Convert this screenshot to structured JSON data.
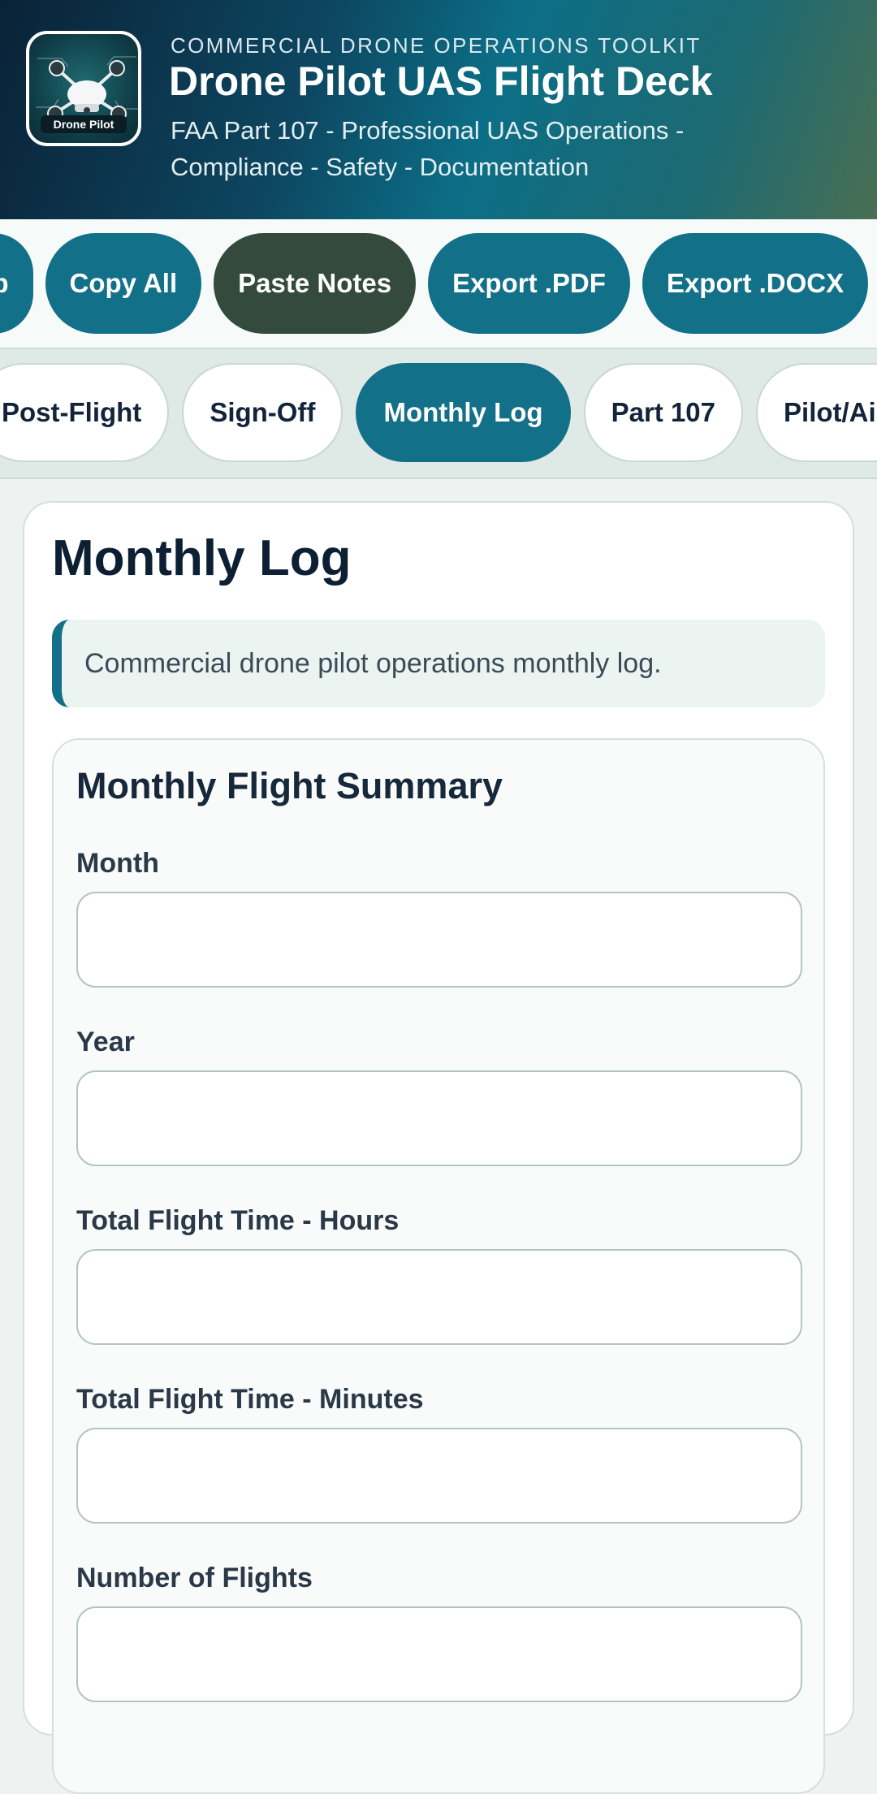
{
  "header": {
    "logo_text": "Drone Pilot",
    "eyebrow": "COMMERCIAL DRONE OPERATIONS TOOLKIT",
    "title": "Drone Pilot UAS Flight Deck",
    "subtitle": "FAA Part 107 - Professional UAS Operations - Compliance - Safety - Documentation"
  },
  "actions": [
    {
      "label": "ab"
    },
    {
      "label": "Copy All"
    },
    {
      "label": "Paste Notes"
    },
    {
      "label": "Export .PDF"
    },
    {
      "label": "Export .DOCX"
    }
  ],
  "tabs": [
    {
      "label": "Post-Flight"
    },
    {
      "label": "Sign-Off"
    },
    {
      "label": "Monthly Log",
      "active": true
    },
    {
      "label": "Part 107"
    },
    {
      "label": "Pilot/Aircr"
    }
  ],
  "main": {
    "title": "Monthly Log",
    "note": "Commercial drone pilot operations monthly log."
  },
  "summary": {
    "title": "Monthly Flight Summary",
    "fields": [
      {
        "label": "Month",
        "value": "",
        "placeholder": ""
      },
      {
        "label": "Year",
        "value": "",
        "placeholder": ""
      },
      {
        "label": "Total Flight Time - Hours",
        "value": "",
        "placeholder": ""
      },
      {
        "label": "Total Flight Time - Minutes",
        "value": "",
        "placeholder": ""
      },
      {
        "label": "Number of Flights",
        "value": "",
        "placeholder": ""
      }
    ]
  },
  "colors": {
    "accent": "#137089",
    "accent_dark": "#334a3d",
    "background": "#eef3f1",
    "title_text": "#0d1f33"
  }
}
